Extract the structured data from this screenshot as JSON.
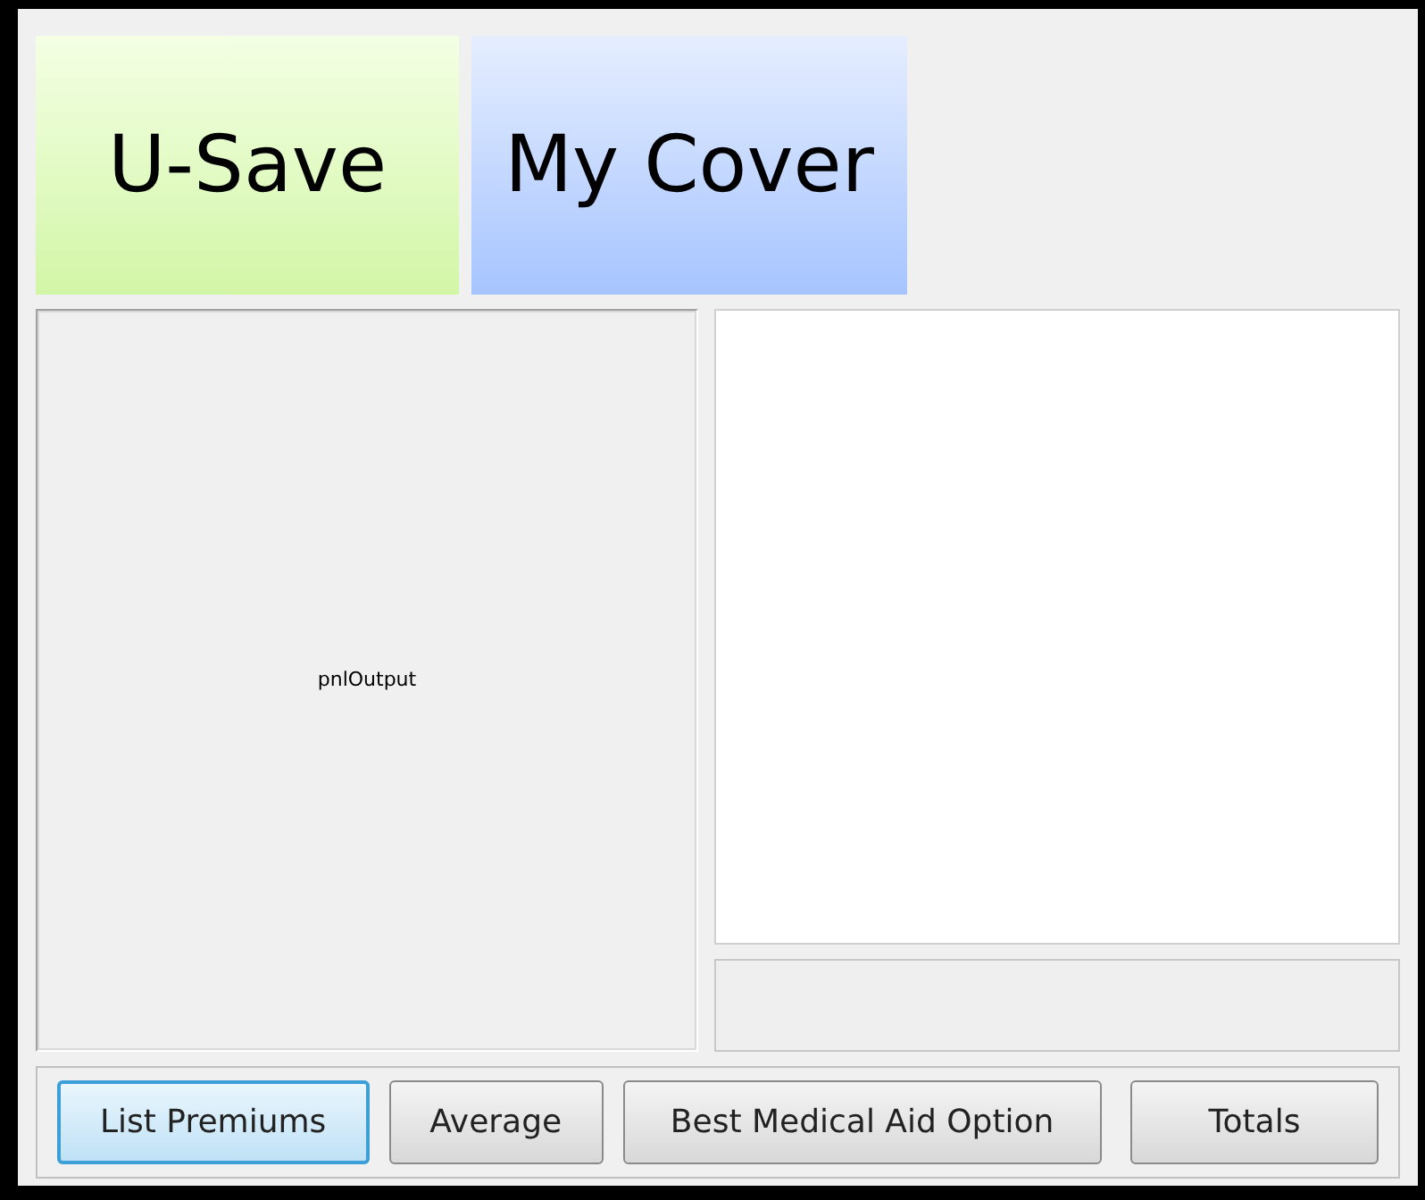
{
  "headers": [
    {
      "label": "U-Save",
      "kind": "green"
    },
    {
      "label": "My Cover",
      "kind": "blue"
    }
  ],
  "output_panel": {
    "label": "pnlOutput"
  },
  "buttons": [
    {
      "label": "List Premiums",
      "selected": true
    },
    {
      "label": "Average",
      "selected": false
    },
    {
      "label": "Best Medical Aid Option",
      "selected": false
    },
    {
      "label": "Totals",
      "selected": false
    }
  ]
}
